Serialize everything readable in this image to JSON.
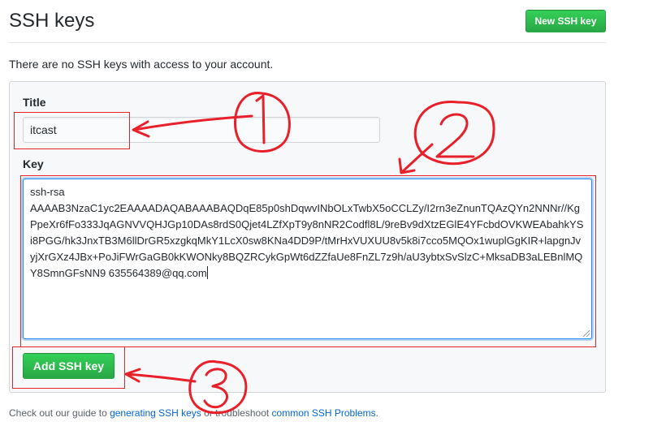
{
  "header": {
    "title": "SSH keys",
    "new_key_label": "New SSH key"
  },
  "empty_message": "There are no SSH keys with access to your account.",
  "form": {
    "title_label": "Title",
    "title_value": "itcast",
    "key_label": "Key",
    "key_value": "ssh-rsa\nAAAAB3NzaC1yc2EAAAADAQABAAABAQDqE85p0shDqwvINbOLxTwbX5oCCLZy/I2rn3eZnunTQAzQYn2NNNr//KgPpeXr6fFo333JqAGNVVQHJGp10DAs8rdS0Qjet4LZfXpT9y8nNR2Codfl8L/9reBv9dXtzEGlE4YFcbdOVKWEAbahkYSi8PGG/hk3JnxTB3M6llDrGR5xzgkqMkY1LcX0sw8KNa4DD9P/tMrHxVUXUU8v5k8i7cco5MQOx1wuplGgKIR+lapgnJvyjXrGXz4JBx+PoJiFWrGaGB0kKWONky8BQZRCykGpWt6dZZfaUe8FnZL7z9h/aU3ybtxSvSlzC+MksaDB3aLEBnlMQY8SmnGFsNN9 635564389@qq.com",
    "add_button_label": "Add SSH key"
  },
  "help": {
    "prefix": "Check out our guide to ",
    "link1": "generating SSH keys",
    "middle": " or troubleshoot ",
    "link2": "common SSH Problems",
    "suffix": "."
  },
  "colors": {
    "annotation_red": "#e8202a",
    "button_green": "#28a745",
    "link_blue": "#0366d6"
  }
}
